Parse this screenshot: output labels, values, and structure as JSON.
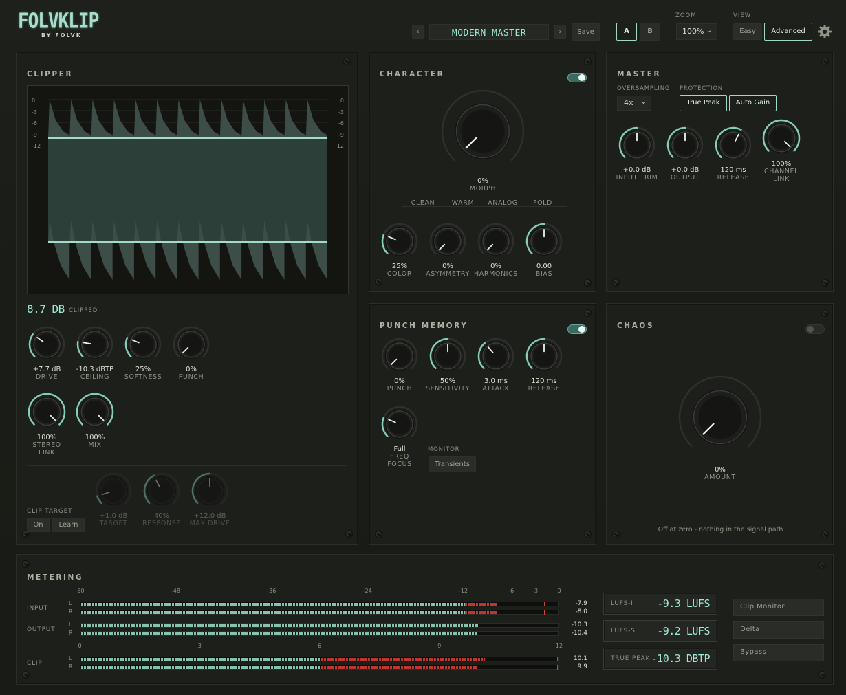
{
  "colors": {
    "accent": "#9fe8d4",
    "clip": "#b9322d",
    "meter": "#7fb5a5",
    "panel": "#1d1f1a"
  },
  "brand": {
    "logo": "FOLVKLIP",
    "by": "BY FOLVK"
  },
  "header": {
    "prev_icon": "chevron-left-icon",
    "next_icon": "chevron-right-icon",
    "preset": "MODERN MASTER",
    "save": "Save",
    "a": "A",
    "b": "B",
    "zoom_label": "ZOOM",
    "zoom_value": "100%",
    "view_label": "VIEW",
    "view_easy": "Easy",
    "view_advanced": "Advanced",
    "settings_icon": "gear-icon"
  },
  "clipper": {
    "title": "CLIPPER",
    "scale": [
      "0",
      "-3",
      "-6",
      "-9",
      "-12"
    ],
    "clipped_value": "8.7 DB",
    "clipped_label": "CLIPPED",
    "knobs": [
      {
        "value": "+7.7 dB",
        "label": "DRIVE",
        "level": 0.3
      },
      {
        "value": "-10.3 dBTP",
        "label": "CEILING",
        "level": 0.2
      },
      {
        "value": "25%",
        "label": "SOFTNESS",
        "level": 0.25
      },
      {
        "value": "0%",
        "label": "PUNCH",
        "level": 0
      }
    ],
    "knobs2": [
      {
        "value": "100%",
        "label1": "STEREO",
        "label2": "LINK",
        "level": 1
      },
      {
        "value": "100%",
        "label1": "MIX",
        "label2": "",
        "level": 1
      }
    ],
    "clip_target_label": "CLIP TARGET",
    "on": "On",
    "learn": "Learn",
    "target_knobs": [
      {
        "value": "+1.0 dB",
        "label": "TARGET",
        "level": 0.1
      },
      {
        "value": "40%",
        "label": "RESPONSE",
        "level": 0.4
      },
      {
        "value": "+12.0 dB",
        "label": "MAX DRIVE",
        "level": 0.5
      }
    ]
  },
  "character": {
    "title": "CHARACTER",
    "enabled": true,
    "morph_value": "0%",
    "morph_label": "MORPH",
    "modes": [
      "CLEAN",
      "WARM",
      "ANALOG",
      "FOLD"
    ],
    "knobs": [
      {
        "value": "25%",
        "label": "COLOR",
        "level": 0.25
      },
      {
        "value": "0%",
        "label": "ASYMMETRY",
        "level": 0
      },
      {
        "value": "0%",
        "label": "HARMONICS",
        "level": 0
      },
      {
        "value": "0.00",
        "label": "BIAS",
        "level": 0.5
      }
    ]
  },
  "master": {
    "title": "MASTER",
    "oversampling_label": "OVERSAMPLING",
    "oversampling_value": "4x",
    "protection_label": "PROTECTION",
    "true_peak": "True Peak",
    "auto_gain": "Auto Gain",
    "knobs": [
      {
        "value": "+0.0 dB",
        "label1": "INPUT TRIM",
        "label2": "",
        "level": 0.5
      },
      {
        "value": "+0.0 dB",
        "label1": "OUTPUT",
        "label2": "",
        "level": 0.5
      },
      {
        "value": "120 ms",
        "label1": "RELEASE",
        "label2": "",
        "level": 0.6
      },
      {
        "value": "100%",
        "label1": "CHANNEL",
        "label2": "LINK",
        "level": 1
      }
    ]
  },
  "punch_memory": {
    "title": "PUNCH MEMORY",
    "enabled": true,
    "knobs": [
      {
        "value": "0%",
        "label": "PUNCH",
        "level": 0
      },
      {
        "value": "50%",
        "label": "SENSITIVITY",
        "level": 0.5
      },
      {
        "value": "3.0 ms",
        "label": "ATTACK",
        "level": 0.35
      },
      {
        "value": "120 ms",
        "label": "RELEASE",
        "level": 0.5
      }
    ],
    "freq_value": "Full",
    "freq_label1": "FREQ",
    "freq_label2": "FOCUS",
    "monitor_label": "MONITOR",
    "monitor_value": "Transients"
  },
  "chaos": {
    "title": "CHAOS",
    "enabled": false,
    "amount_value": "0%",
    "amount_label": "AMOUNT",
    "note": "Off at zero - nothing in the signal path"
  },
  "metering": {
    "title": "METERING",
    "db_scale": [
      "-60",
      "-48",
      "-36",
      "-24",
      "-12",
      "-6",
      "-3",
      "0"
    ],
    "clip_scale": [
      "0",
      "3",
      "6",
      "9",
      "12"
    ],
    "input_label": "INPUT",
    "output_label": "OUTPUT",
    "clip_label": "CLIP",
    "l": "L",
    "r": "R",
    "input_l": "-7.9",
    "input_r": "-8.0",
    "output_l": "-10.3",
    "output_r": "-10.4",
    "clip_l": "10.1",
    "clip_r": "9.9",
    "lufs_i_label": "LUFS-I",
    "lufs_i": "-9.3 LUFS",
    "lufs_s_label": "LUFS-S",
    "lufs_s": "-9.2 LUFS",
    "tp_label": "TRUE PEAK",
    "tp": "-10.3 DBTP",
    "clip_monitor": "Clip Monitor",
    "delta": "Delta",
    "bypass": "Bypass"
  }
}
